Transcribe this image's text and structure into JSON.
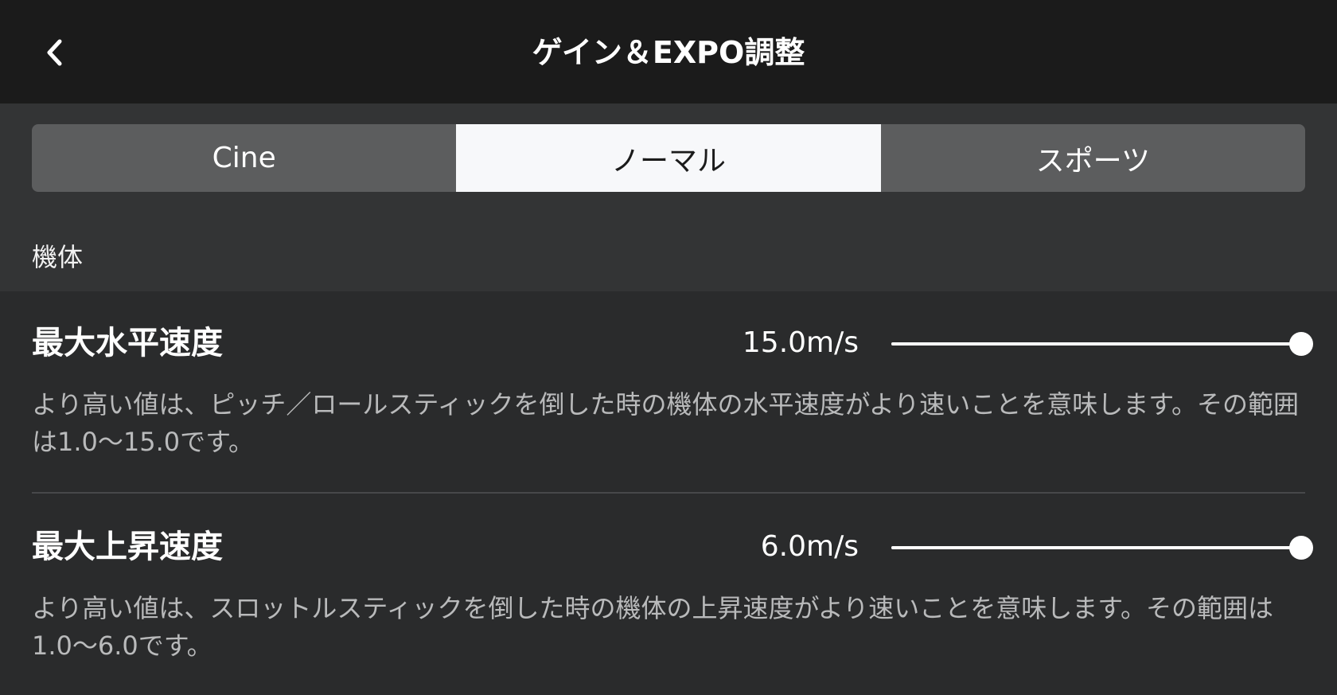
{
  "header": {
    "title": "ゲイン＆EXPO調整",
    "back_icon": "chevron-left-icon"
  },
  "tabs": [
    {
      "label": "Cine",
      "active": false
    },
    {
      "label": "ノーマル",
      "active": true
    },
    {
      "label": "スポーツ",
      "active": false
    }
  ],
  "section": {
    "label": "機体"
  },
  "settings": [
    {
      "name": "最大水平速度",
      "value": "15.0m/s",
      "slider_fraction": 1.0,
      "description": "より高い値は、ピッチ／ロールスティックを倒した時の機体の水平速度がより速いことを意味します。その範囲は1.0〜15.0です。"
    },
    {
      "name": "最大上昇速度",
      "value": "6.0m/s",
      "slider_fraction": 1.0,
      "description": "より高い値は、スロットルスティックを倒した時の機体の上昇速度がより速いことを意味します。その範囲は1.0〜6.0です。"
    }
  ],
  "colors": {
    "header_bg": "#1b1b1b",
    "page_bg": "#2a2b2c",
    "tab_bg": "#5c5d5e",
    "tab_active_bg": "#f7f8fa",
    "description_text": "#b9babb"
  }
}
